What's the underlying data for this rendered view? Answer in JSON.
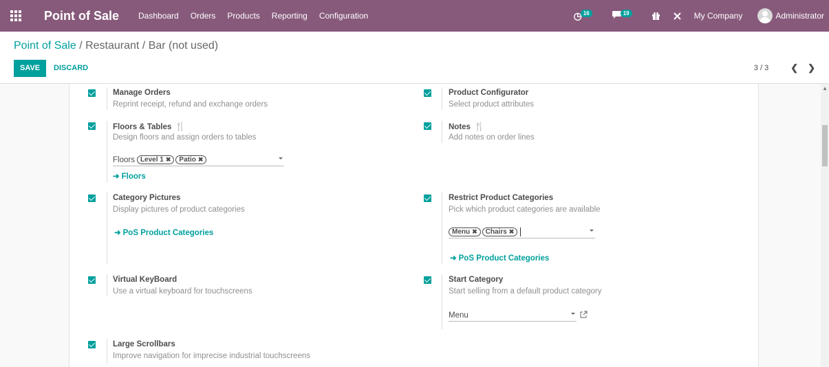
{
  "navbar": {
    "app_title": "Point of Sale",
    "menu": [
      "Dashboard",
      "Orders",
      "Products",
      "Reporting",
      "Configuration"
    ],
    "activity_count": "16",
    "message_count": "19",
    "company": "My Company",
    "user": "Administrator"
  },
  "breadcrumb": {
    "root": "Point of Sale",
    "separator": "/",
    "current": "Restaurant / Bar (not used)"
  },
  "actions": {
    "save": "SAVE",
    "discard": "DISCARD"
  },
  "pager": {
    "value": "3 / 3"
  },
  "settings": {
    "manage_orders": {
      "title": "Manage Orders",
      "desc": "Reprint receipt, refund and exchange orders"
    },
    "product_configurator": {
      "title": "Product Configurator",
      "desc": "Select product attributes"
    },
    "floors_tables": {
      "title": "Floors & Tables",
      "desc": "Design floors and assign orders to tables",
      "field_label": "Floors",
      "tags": [
        "Level 1",
        "Patio"
      ],
      "link": "Floors"
    },
    "notes": {
      "title": "Notes",
      "desc": "Add notes on order lines"
    },
    "category_pictures": {
      "title": "Category Pictures",
      "desc": "Display pictures of product categories",
      "link": "PoS Product Categories"
    },
    "restrict_categories": {
      "title": "Restrict Product Categories",
      "desc": "Pick which product categories are available",
      "tags": [
        "Menu",
        "Chairs"
      ],
      "link": "PoS Product Categories"
    },
    "virtual_keyboard": {
      "title": "Virtual KeyBoard",
      "desc": "Use a virtual keyboard for touchscreens"
    },
    "start_category": {
      "title": "Start Category",
      "desc": "Start selling from a default product category",
      "value": "Menu"
    },
    "large_scrollbars": {
      "title": "Large Scrollbars",
      "desc": "Improve navigation for imprecise industrial touchscreens"
    }
  },
  "colors": {
    "brand": "#875a7b",
    "accent": "#00a09d"
  }
}
